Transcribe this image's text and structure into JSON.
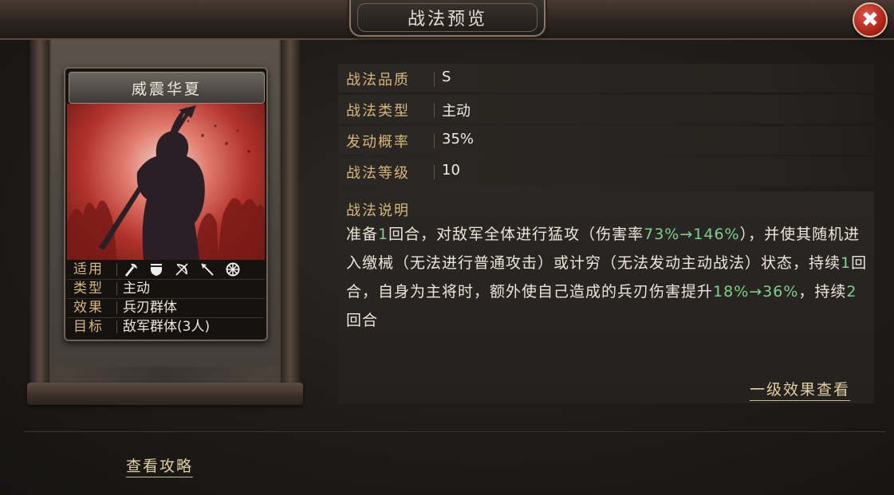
{
  "header": {
    "title": "战法预览",
    "close_label": "✖"
  },
  "card": {
    "name": "威震华夏",
    "rows": [
      {
        "key": "适用",
        "icons": [
          "axe-icon",
          "shield-icon",
          "bow-icon",
          "spear-icon",
          "wheel-icon"
        ]
      },
      {
        "key": "类型",
        "value": "主动"
      },
      {
        "key": "效果",
        "value": "兵刃群体"
      },
      {
        "key": "目标",
        "value": "敌军群体(3人)"
      }
    ]
  },
  "stats": [
    {
      "key": "战法品质",
      "value": "S"
    },
    {
      "key": "战法类型",
      "value": "主动"
    },
    {
      "key": "发动概率",
      "value": "35%"
    },
    {
      "key": "战法等级",
      "value": "10"
    }
  ],
  "description": {
    "title": "战法说明",
    "p1": "准备",
    "n1": "1",
    "p2": "回合，对敌军全体进行猛攻（伤害率",
    "n2": "73%→146%",
    "p3": "），并使其随机进入缴械（无法进行普通攻击）或计穷（无法发动主动战法）状态，持续",
    "n3": "1",
    "p4": "回合，自身为主将时，额外使自己造成的兵刃伤害提升",
    "n4": "18%→36%",
    "p5": "，持续",
    "n5": "2",
    "p6": "回合"
  },
  "links": {
    "level_effect": "一级效果查看",
    "guide": "查看攻略"
  },
  "colors": {
    "accent_gold": "#d7b77b",
    "highlight_green": "#7ed08a",
    "close_red": "#a81f17"
  }
}
